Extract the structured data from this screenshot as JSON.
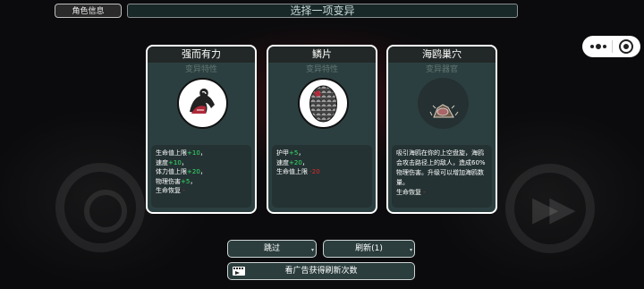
{
  "header": {
    "role_info_label": "角色信息",
    "title": "选择一项变异"
  },
  "cards": [
    {
      "name": "强而有力",
      "category": "变异特性",
      "icon": "flexed-arm-icon",
      "stats": [
        {
          "label": "生命值上限",
          "value": "+10",
          "suffix": "，"
        },
        {
          "label": "速度",
          "value": "+10",
          "suffix": "，"
        },
        {
          "label": "体力值上限",
          "value": "+20",
          "suffix": "，"
        },
        {
          "label": "物理伤害",
          "value": "+5",
          "suffix": "，"
        },
        {
          "label": "生命恢复",
          "value": "-",
          "suffix": ""
        }
      ]
    },
    {
      "name": "鳞片",
      "category": "变异特性",
      "icon": "scales-icon",
      "stats": [
        {
          "label": "护甲",
          "value": "+5",
          "suffix": "，"
        },
        {
          "label": "速度",
          "value": "+20",
          "suffix": "，"
        },
        {
          "label": "生命值上限",
          "value": "-20",
          "suffix": ""
        }
      ]
    },
    {
      "name": "海鸥巢穴",
      "category": "变异器官",
      "icon": "nest-icon",
      "description": "吸引海鸥在你的上空盘旋，海鸥会攻击路径上的敌人，造成60%物理伤害。升级可以增加海鸥数量。",
      "extra_label": "生命恢复",
      "extra_value": "-"
    }
  ],
  "buttons": {
    "skip": "跳过",
    "refresh": "刷新(1)",
    "watch_ad": "看广告获得刷新次数"
  },
  "colors": {
    "positive": "#36e06a",
    "negative": "#e02a2a",
    "card_bg": "#2c3f40"
  }
}
